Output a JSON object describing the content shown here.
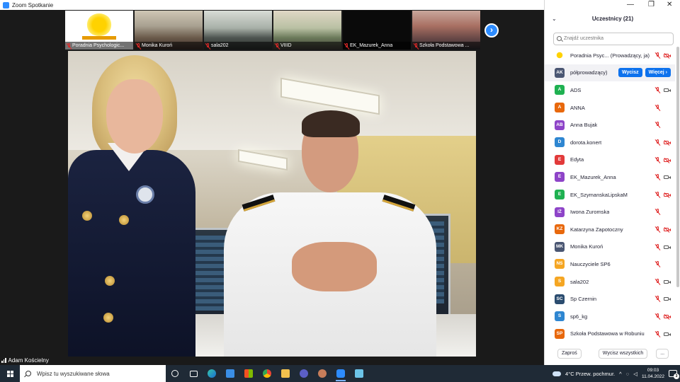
{
  "window": {
    "title": "Zoom Spotkanie"
  },
  "thumbnails": [
    {
      "label": "Poradnia Psychologic...",
      "muted": true,
      "style": "t-logo"
    },
    {
      "label": "Monika Kuroń",
      "muted": true,
      "style": "t-room1"
    },
    {
      "label": "sala202",
      "muted": true,
      "style": "t-room2"
    },
    {
      "label": "VIIID",
      "muted": true,
      "style": "t-room3"
    },
    {
      "label": "EK_Mazurek_Anna",
      "muted": true,
      "style": "t-black"
    },
    {
      "label": "Szkoła Podstawowa ...",
      "muted": true,
      "style": "t-room4"
    }
  ],
  "next_arrow_icon": "chevron-right-icon",
  "active_speaker": {
    "name": "Adam Kościelny"
  },
  "participants_panel": {
    "title": "Uczestnicy (21)",
    "search_placeholder": "Znajdź uczestnika",
    "rows": [
      {
        "initials": "",
        "name": "Poradnia Psyc... (Prowadzący, ja)",
        "color": "#ffffff",
        "logo": true,
        "mic_off": true,
        "cam_off": true
      },
      {
        "initials": "AK",
        "name": "półprowadzący)",
        "color": "#4a5672",
        "highlight": true,
        "mute_button": "Wycisz",
        "more_button": "Więcej ›"
      },
      {
        "initials": "A",
        "name": "ADS",
        "color": "#1fb151",
        "mic_off": true,
        "cam_off": false
      },
      {
        "initials": "A",
        "name": "ANNA",
        "color": "#e8680c",
        "mic_off": true,
        "cam": false
      },
      {
        "initials": "AB",
        "name": "Anna Bujak",
        "color": "#8e44c8",
        "mic_off": true,
        "cam": false
      },
      {
        "initials": "D",
        "name": "dorota.konert",
        "color": "#2e86d1",
        "mic_off": true,
        "cam_off": true
      },
      {
        "initials": "E",
        "name": "Edyta",
        "color": "#e23a3a",
        "mic_off": true,
        "cam_off": true
      },
      {
        "initials": "E",
        "name": "EK_Mazurek_Anna",
        "color": "#8e44c8",
        "mic_off": true,
        "cam_off": false
      },
      {
        "initials": "E",
        "name": "EK_SzymanskaLipskaM",
        "color": "#1fb151",
        "mic_off": true,
        "cam_off": true
      },
      {
        "initials": "IŻ",
        "name": "Iwona Zuromska",
        "color": "#8e44c8",
        "mic_off": true,
        "cam": false
      },
      {
        "initials": "KZ",
        "name": "Katarzyna Zapotoczny",
        "color": "#e8680c",
        "mic_off": true,
        "cam_off": true
      },
      {
        "initials": "MK",
        "name": "Monika Kuroń",
        "color": "#4a5672",
        "mic_off": true,
        "cam_off": false
      },
      {
        "initials": "NS",
        "name": "Nauczyciele SP6",
        "color": "#f5a623",
        "mic_off": true,
        "cam": false
      },
      {
        "initials": "S",
        "name": "sala202",
        "color": "#f5a623",
        "mic_off": true,
        "cam_off": false
      },
      {
        "initials": "SC",
        "name": "Sp Czernin",
        "color": "#2b4c6f",
        "mic_off": true,
        "cam_off": false
      },
      {
        "initials": "S",
        "name": "sp6_kg",
        "color": "#2e86d1",
        "mic_off": true,
        "cam_off": true
      },
      {
        "initials": "SP",
        "name": "Szkoła Podstawowa w Robuniu",
        "color": "#e8680c",
        "mic_off": true,
        "cam_off": false
      }
    ],
    "footer": {
      "invite": "Zaproś",
      "mute_all": "Wycisz wszystkich",
      "more": "..."
    }
  },
  "taskbar": {
    "search_placeholder": "Wpisz tu wyszukiwane słowa",
    "weather": "4°C  Przew. pochmur.",
    "time": "09:03",
    "date": "11.04.2022",
    "notifications": "3"
  }
}
